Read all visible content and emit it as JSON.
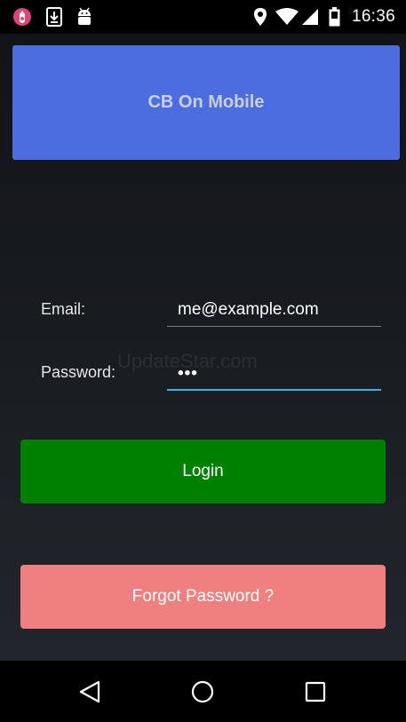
{
  "status_bar": {
    "time": "16:36",
    "icons": [
      "app-notification-icon",
      "download-icon",
      "android-debug-icon",
      "location-icon",
      "wifi-icon",
      "signal-icon",
      "battery-icon"
    ]
  },
  "header": {
    "title": "CB On Mobile",
    "color": "#4c6de0"
  },
  "form": {
    "email_label": "Email:",
    "email_value": "me@example.com",
    "password_label": "Password:",
    "password_value": "•••"
  },
  "watermark": "UpdateStar.com",
  "buttons": {
    "login_label": "Login",
    "login_color": "#008000",
    "forgot_label": "Forgot Password ?",
    "forgot_color": "#f08080"
  },
  "nav_bar": {
    "icons": [
      "back-icon",
      "home-icon",
      "recents-icon"
    ]
  }
}
